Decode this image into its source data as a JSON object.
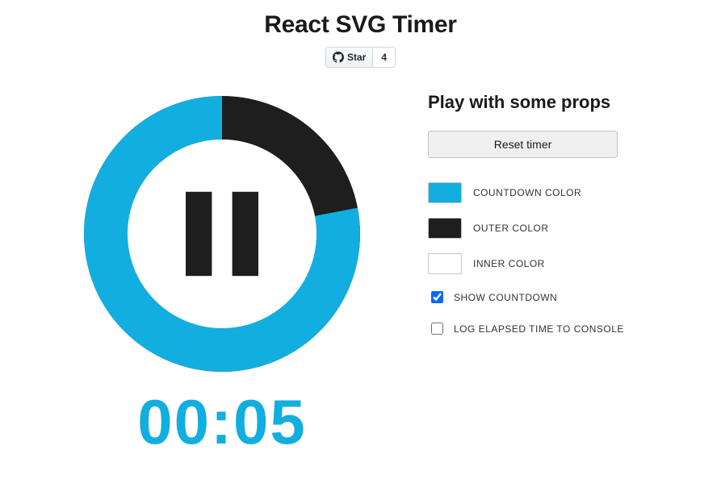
{
  "title": "React SVG Timer",
  "github": {
    "star_label": "Star",
    "star_count": "4"
  },
  "timer": {
    "countdown_text": "00:05",
    "countdown_color": "#12aee0",
    "outer_color": "#1e1e1e",
    "inner_color": "#ffffff",
    "progress_fraction": 0.78
  },
  "props_panel": {
    "heading": "Play with some props",
    "reset_label": "Reset timer",
    "color_props": [
      {
        "label": "COUNTDOWN COLOR",
        "color": "#12aee0"
      },
      {
        "label": "OUTER COLOR",
        "color": "#1e1e1e"
      },
      {
        "label": "INNER COLOR",
        "color": "#ffffff"
      }
    ],
    "checkboxes": [
      {
        "label": "SHOW COUNTDOWN",
        "checked": true
      },
      {
        "label": "LOG ELAPSED TIME TO CONSOLE",
        "checked": false
      }
    ]
  }
}
